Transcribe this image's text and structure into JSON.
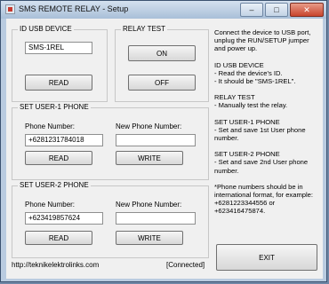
{
  "window": {
    "title": "SMS REMOTE RELAY - Setup",
    "minimize": "–",
    "maximize": "□",
    "close": "✕"
  },
  "id_usb": {
    "title": "ID USB DEVICE",
    "value": "SMS-1REL",
    "read": "READ"
  },
  "relay_test": {
    "title": "RELAY TEST",
    "on": "ON",
    "off": "OFF"
  },
  "user1": {
    "title": "SET USER-1 PHONE",
    "phone_label": "Phone Number:",
    "phone_value": "+6281231784018",
    "new_label": "New Phone Number:",
    "new_value": "",
    "read": "READ",
    "write": "WRITE"
  },
  "user2": {
    "title": "SET USER-2 PHONE",
    "phone_label": "Phone Number:",
    "phone_value": "+623419857624",
    "new_label": "New Phone Number:",
    "new_value": "",
    "read": "READ",
    "write": "WRITE"
  },
  "footer": {
    "url": "http://teknikelektrolinks.com",
    "status": "[Connected]",
    "exit": "EXIT"
  },
  "help": {
    "p1": "Connect the device to USB port, unplug the RUN/SETUP jumper and power up.",
    "p2": [
      "ID USB DEVICE",
      "- Read the device's ID.",
      "- It should be \"SMS-1REL\"."
    ],
    "p3": [
      "RELAY TEST",
      "- Manually test the relay."
    ],
    "p4": [
      "SET USER-1 PHONE",
      "- Set and save 1st User phone number."
    ],
    "p5": [
      "SET USER-2 PHONE",
      "- Set and save 2nd User phone number."
    ],
    "p6": "*Phone numbers should be in international format, for example: +6281223344556 or +623416475874."
  }
}
